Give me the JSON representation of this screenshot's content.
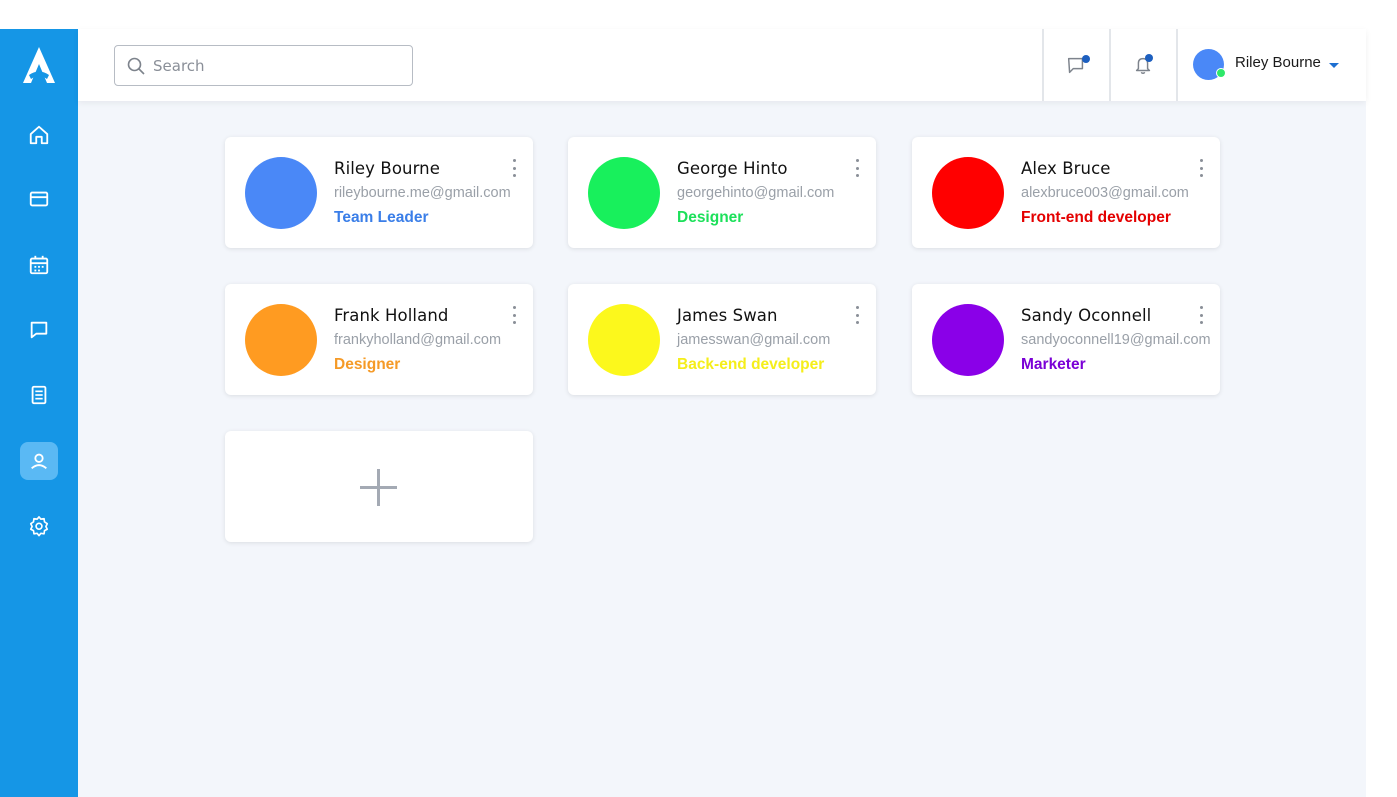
{
  "search": {
    "placeholder": "Search"
  },
  "sidebar": {
    "items": [
      {
        "icon": "home-icon"
      },
      {
        "icon": "credit-card-icon"
      },
      {
        "icon": "calendar-icon"
      },
      {
        "icon": "chat-icon"
      },
      {
        "icon": "document-icon"
      },
      {
        "icon": "user-icon",
        "active": true
      },
      {
        "icon": "settings-icon"
      }
    ]
  },
  "header": {
    "user_name": "Riley Bourne"
  },
  "colors": {
    "sidebar": "#1596e6",
    "active_nav": "#5ab9f4",
    "background": "#f3f6fb"
  },
  "team": [
    {
      "name": "Riley Bourne",
      "email": "rileybourne.me@gmail.com",
      "role": "Team Leader",
      "color": "#4a88f7",
      "role_color": "#3a7ee8"
    },
    {
      "name": "George Hinto",
      "email": "georgehinto@gmail.com",
      "role": "Designer",
      "color": "#18f05c",
      "role_color": "#1ce05a"
    },
    {
      "name": "Alex Bruce",
      "email": "alexbruce003@gmail.com",
      "role": "Front-end developer",
      "color": "#ff0000",
      "role_color": "#e40000"
    },
    {
      "name": "Frank Holland",
      "email": "frankyholland@gmail.com",
      "role": "Designer",
      "color": "#ff9b21",
      "role_color": "#f59a27"
    },
    {
      "name": "James Swan",
      "email": "jamesswan@gmail.com",
      "role": "Back-end developer",
      "color": "#fcf81c",
      "role_color": "#f5ee1a"
    },
    {
      "name": "Sandy Oconnell",
      "email": "sandyoconnell19@gmail.com",
      "role": "Marketer",
      "color": "#8a00e8",
      "role_color": "#7a00d6"
    }
  ]
}
